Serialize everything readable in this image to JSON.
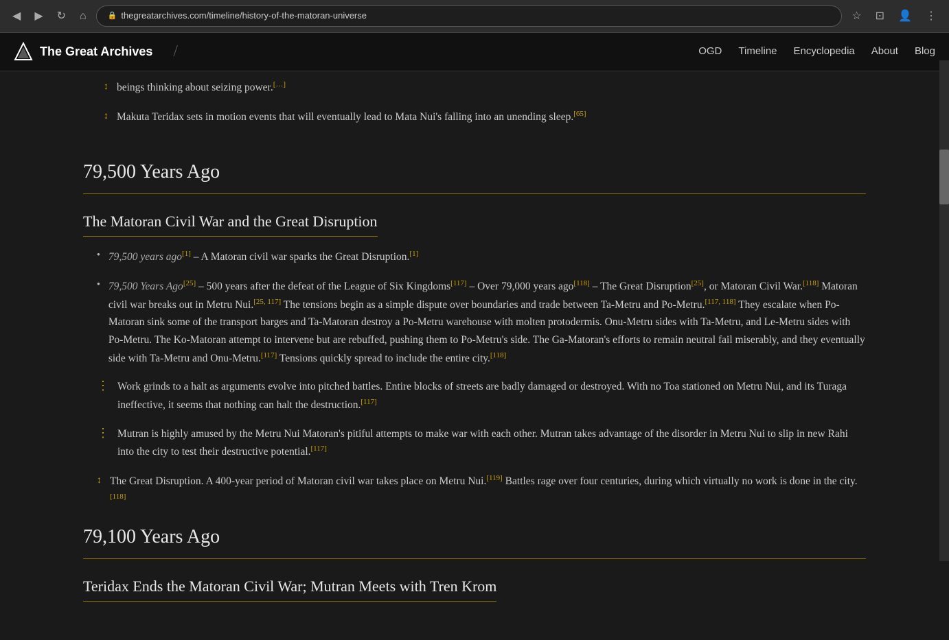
{
  "browser": {
    "url": "thegreatarchives.com/timeline/history-of-the-matoran-universe",
    "back_icon": "◀",
    "forward_icon": "▶",
    "refresh_icon": "↻",
    "home_icon": "⌂",
    "lock_icon": "🔒",
    "star_icon": "☆",
    "menu_icon": "⋮"
  },
  "header": {
    "site_name": "The Great Archives",
    "logo_icon": "△",
    "divider": "/",
    "nav_items": [
      "OGD",
      "Timeline",
      "Encyclopedia",
      "About",
      "Blog"
    ]
  },
  "content": {
    "scroll_hint_items": [
      {
        "text": "beings thinking about seizing power.",
        "ref": "[…]",
        "arrow": "↕"
      },
      {
        "text": "Makuta Teridax sets in motion events that will eventually lead to Mata Nui's falling into an unending sleep.",
        "ref": "[65]",
        "arrow": "↕"
      }
    ],
    "section1": {
      "year_heading": "79,500 Years Ago",
      "subsection_heading": "The Matoran Civil War and the Great Disruption",
      "bullets": [
        {
          "type": "standard",
          "italic_prefix": "79,500 years ago",
          "ref1": "[1]",
          "text": " – A Matoran civil war sparks the Great Disruption.",
          "ref2": "[1]"
        },
        {
          "type": "standard",
          "italic_prefix": "79,500 Years Ago",
          "ref1": "[25]",
          "text": " – 500 years after the defeat of the League of Six Kingdoms",
          "ref2": "[117]",
          "text2": " – Over 79,000 years ago",
          "ref3": "[118]",
          "text3": " – The Great Disruption",
          "ref4": "[25]",
          "text4": ", or Matoran Civil War.",
          "ref5": "[118]",
          "text5": " Matoran civil war breaks out in Metru Nui.",
          "refs6": "[25, 117]",
          "text6": " The tensions begin as a simple dispute over boundaries and trade between Ta-Metru and Po-Metru.",
          "ref7": "[117, 118]",
          "text7": " They escalate when Po-Matoran sink some of the transport barges and Ta-Matoran destroy a Po-Metru warehouse with molten protodermis. Onu-Metru sides with Ta-Metru, and Le-Metru sides with Po-Metru. The Ko-Matoran attempt to intervene but are rebuffed, pushing them to Po-Metru's side. The Ga-Matoran's efforts to remain neutral fail miserably, and they eventually side with Ta-Metru and Onu-Metru.",
          "ref8": "[117]",
          "text8": " Tensions quickly spread to include the entire city.",
          "ref9": "[118]"
        },
        {
          "type": "vertical",
          "text": "Work grinds to a halt as arguments evolve into pitched battles. Entire blocks of streets are badly damaged or destroyed. With no Toa stationed on Metru Nui, and its Turaga ineffective, it seems that nothing can halt the destruction.",
          "ref": "[117]"
        },
        {
          "type": "vertical",
          "text": "Mutran is highly amused by the Metru Nui Matoran's pitiful attempts to make war with each other. Mutran takes advantage of the disorder in Metru Nui to slip in new Rahi into the city to test their destructive potential.",
          "ref": "[117]"
        },
        {
          "type": "vertical_arrow",
          "text": "The Great Disruption. A 400-year period of Matoran civil war takes place on Metru Nui.",
          "ref1": "[119]",
          "text2": " Battles rage over four centuries, during which virtually no work is done in the city.",
          "ref2": "[118]"
        }
      ]
    },
    "section2": {
      "year_heading": "79,100 Years Ago",
      "subsection_heading": "Teridax Ends the Matoran Civil War; Mutran Meets with Tren Krom"
    }
  }
}
